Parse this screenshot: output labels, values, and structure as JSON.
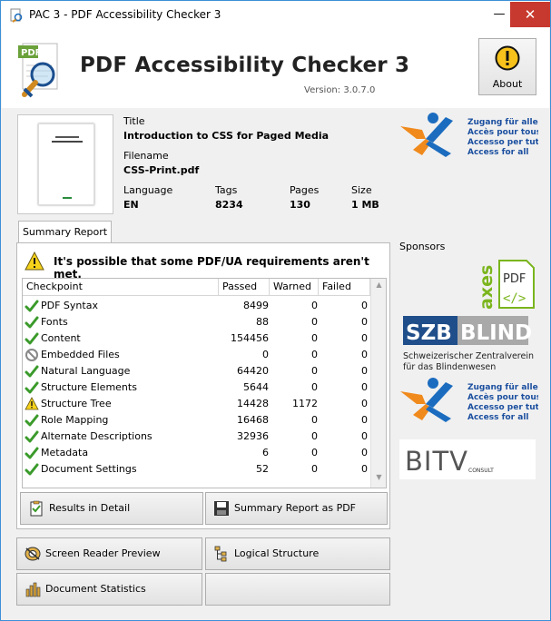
{
  "window": {
    "title": "PAC 3 - PDF Accessibility Checker 3"
  },
  "header": {
    "app_name": "PDF Accessibility Checker 3",
    "version": "Version: 3.0.7.0",
    "about_label": "About",
    "logo_badge": "PDF"
  },
  "document": {
    "thumb_title": "Introduction to CSS for Paged Media",
    "title_label": "Title",
    "title": "Introduction to CSS for Paged Media",
    "filename_label": "Filename",
    "filename": "CSS-Print.pdf",
    "language_label": "Language",
    "language": "EN",
    "tags_label": "Tags",
    "tags": "8234",
    "pages_label": "Pages",
    "pages": "130",
    "size_label": "Size",
    "size": "1 MB"
  },
  "report": {
    "tab_label": "Summary Report",
    "message": "It's possible that some PDF/UA requirements aren't met.",
    "columns": [
      "Checkpoint",
      "Passed",
      "Warned",
      "Failed"
    ],
    "rows": [
      {
        "name": "PDF Syntax",
        "status": "pass",
        "passed": "8499",
        "warned": "0",
        "failed": "0"
      },
      {
        "name": "Fonts",
        "status": "pass",
        "passed": "88",
        "warned": "0",
        "failed": "0"
      },
      {
        "name": "Content",
        "status": "pass",
        "passed": "154456",
        "warned": "0",
        "failed": "0"
      },
      {
        "name": "Embedded Files",
        "status": "na",
        "passed": "0",
        "warned": "0",
        "failed": "0"
      },
      {
        "name": "Natural Language",
        "status": "pass",
        "passed": "64420",
        "warned": "0",
        "failed": "0"
      },
      {
        "name": "Structure Elements",
        "status": "pass",
        "passed": "5644",
        "warned": "0",
        "failed": "0"
      },
      {
        "name": "Structure Tree",
        "status": "warn",
        "passed": "14428",
        "warned": "1172",
        "failed": "0"
      },
      {
        "name": "Role Mapping",
        "status": "pass",
        "passed": "16468",
        "warned": "0",
        "failed": "0"
      },
      {
        "name": "Alternate Descriptions",
        "status": "pass",
        "passed": "32936",
        "warned": "0",
        "failed": "0"
      },
      {
        "name": "Metadata",
        "status": "pass",
        "passed": "6",
        "warned": "0",
        "failed": "0"
      },
      {
        "name": "Document Settings",
        "status": "pass",
        "passed": "52",
        "warned": "0",
        "failed": "0"
      }
    ],
    "results_btn": "Results in Detail",
    "pdf_btn": "Summary Report as PDF"
  },
  "tools": {
    "screen_reader": "Screen Reader Preview",
    "logical_structure": "Logical Structure",
    "doc_stats": "Document Statistics"
  },
  "sponsors": {
    "label": "Sponsors",
    "zugang_lines": [
      "Zugang für alle",
      "Accès pour tous",
      "Accesso per tutti",
      "Access for all"
    ],
    "axes_text": "axes",
    "axes_pdf": "PDF",
    "szb_main": "SZB",
    "szb_blind": "BLIND",
    "szb_lines": [
      "Schweizerischer Zentralverein",
      "für das Blindenwesen"
    ],
    "bitv_text": "BITV",
    "bitv_sub": "CONSULT"
  },
  "colors": {
    "accent_blue": "#1b6cbf",
    "check_green": "#3a9a2a",
    "warn_yellow": "#f6d21b",
    "close_red": "#c7392e"
  }
}
